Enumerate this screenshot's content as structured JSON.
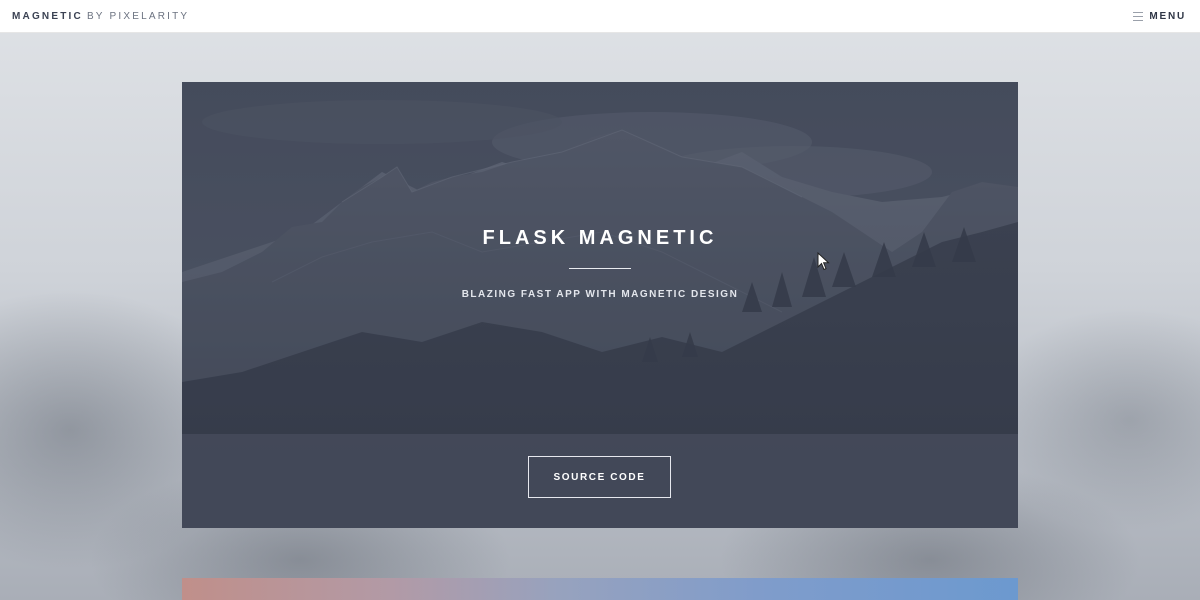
{
  "header": {
    "logo_strong": "MAGNETIC",
    "logo_light": "BY PIXELARITY",
    "menu_label": "MENU",
    "menu_icon": "hamburger-icon"
  },
  "hero": {
    "title": "FLASK MAGNETIC",
    "subtitle": "BLAZING FAST APP WITH MAGNETIC DESIGN",
    "button_label": "SOURCE CODE",
    "background_image": "mountain-landscape-photo"
  },
  "next_card": {
    "background_image": "gradient-preview-photo"
  },
  "colors": {
    "header_bg": "#ffffff",
    "text_dark": "#2f3646",
    "hero_overlay": "#474e5c",
    "button_border": "#e6e8ee"
  }
}
